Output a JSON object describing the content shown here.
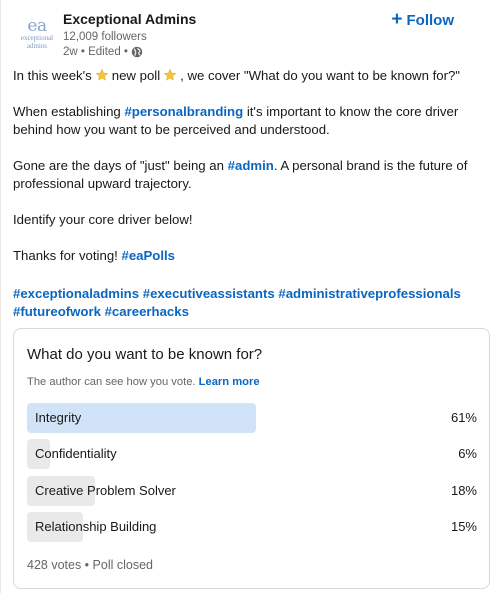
{
  "author": {
    "logo_text": "ea",
    "logo_line1": "exceptional",
    "logo_line2": "admins",
    "name": "Exceptional Admins",
    "followers": "12,009 followers",
    "meta": "2w • Edited •",
    "follow_label": "Follow"
  },
  "post": {
    "l1_a": "In this week's",
    "l1_b": "new poll",
    "l1_c": ", we cover \"What do you want to be known for?\"",
    "l2_a": "When establishing",
    "l2_tag": "#personalbranding",
    "l2_b": "it's important to know the core driver",
    "l3": "behind how you want to be perceived and understood.",
    "l4_a": "Gone are the days of \"just\" being an",
    "l4_tag": "#admin",
    "l4_b": ". A personal brand is the future of",
    "l5": "professional upward trajectory.",
    "l6": "Identify your core driver below!",
    "l7_a": "Thanks for voting!",
    "l7_tag": "#eaPolls",
    "tags_row1": [
      "#exceptionaladmins",
      "#executiveassistants",
      "#administrativeprofessionals"
    ],
    "tags_row2": [
      "#futureofwork",
      "#careerhacks"
    ]
  },
  "poll": {
    "question": "What do you want to be known for?",
    "note": "The author can see how you vote.",
    "learn_more": "Learn more",
    "options": [
      {
        "label": "Integrity",
        "percent": "61%",
        "share": 0.61,
        "leading": true
      },
      {
        "label": "Confidentiality",
        "percent": "6%",
        "share": 0.06,
        "leading": false
      },
      {
        "label": "Creative Problem Solver",
        "percent": "18%",
        "share": 0.18,
        "leading": false
      },
      {
        "label": "Relationship Building",
        "percent": "15%",
        "share": 0.15,
        "leading": false
      }
    ],
    "footer": "428 votes • Poll closed"
  },
  "colors": {
    "link": "#0a66c2",
    "leading_bar": "#d0e3f7",
    "bar": "#e9e9e9",
    "star": "#f5c33b"
  },
  "icons": {
    "star": "star-emoji-icon",
    "globe": "globe-icon",
    "plus": "plus-icon"
  }
}
